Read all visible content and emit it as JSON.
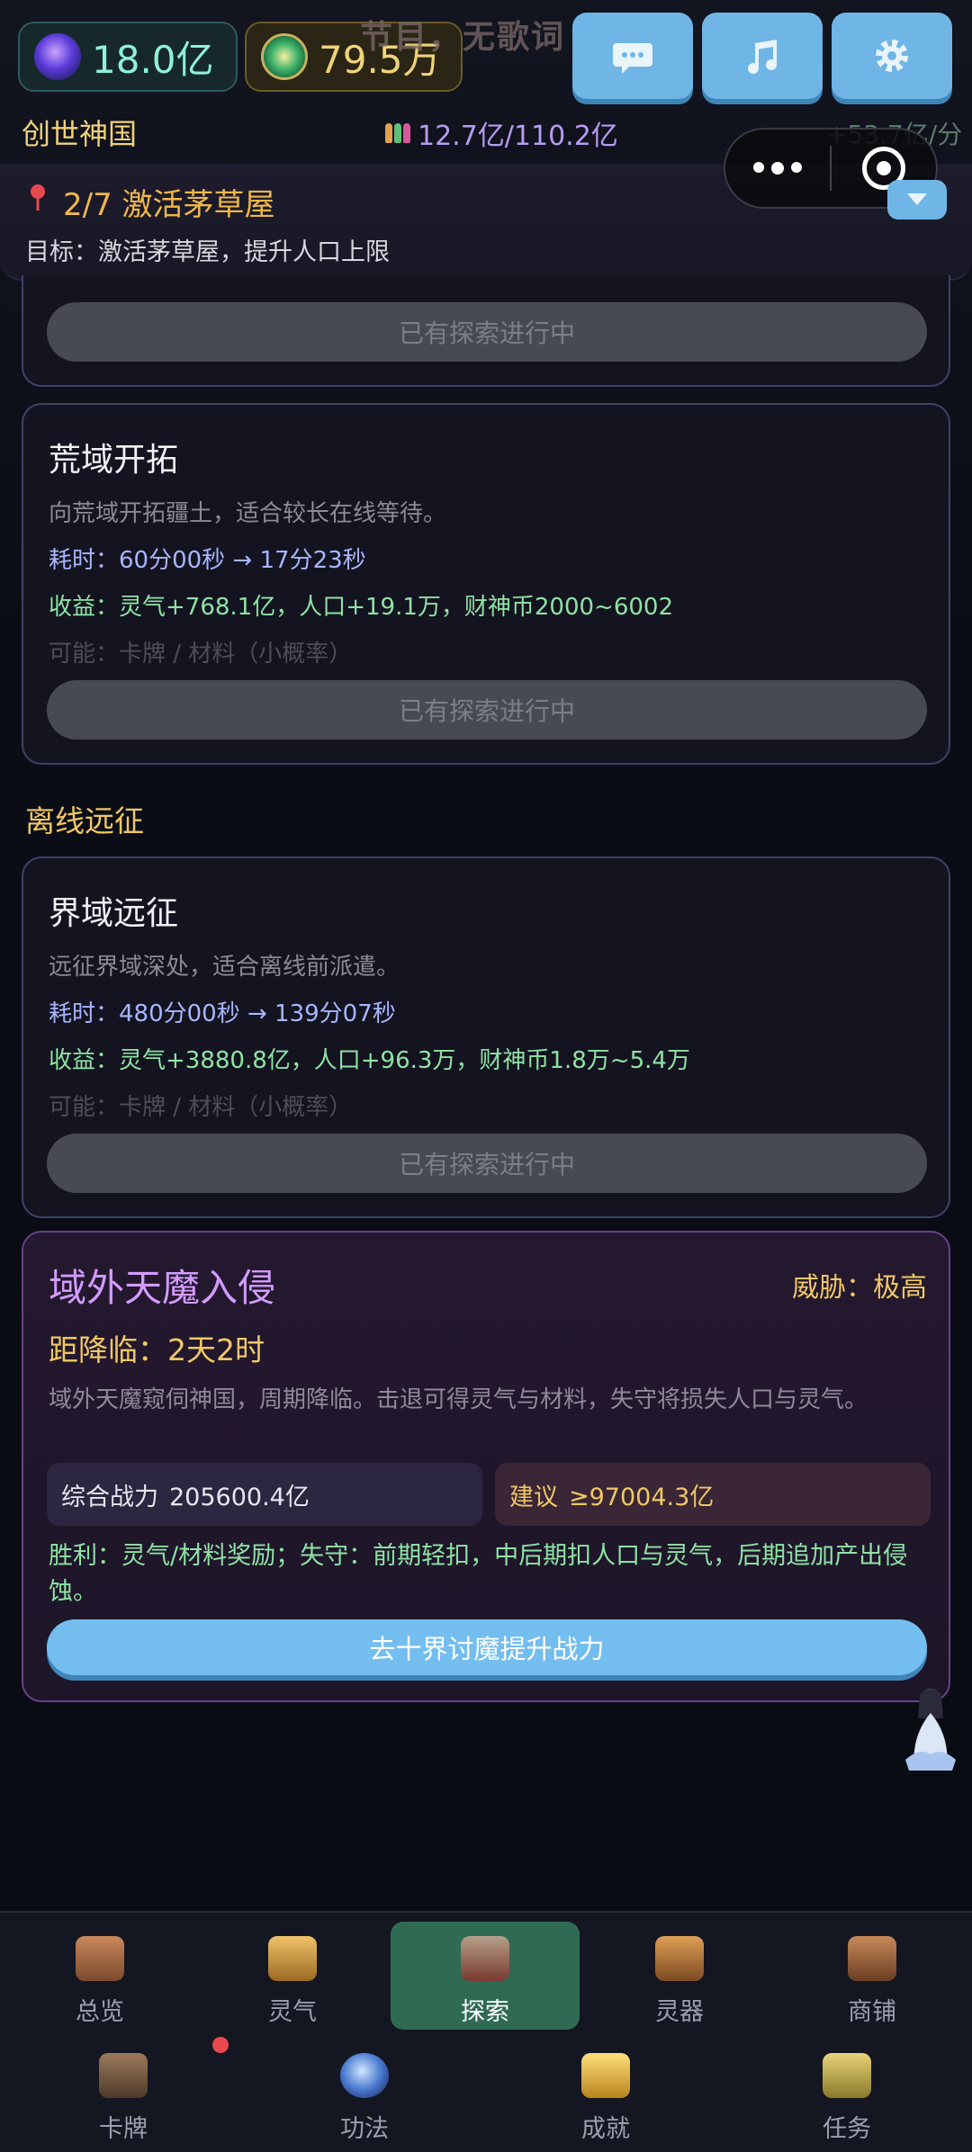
{
  "header": {
    "spirit_value": "18.0亿",
    "coin_value": "79.5万",
    "banner_ghost": "节目，无歌词",
    "kingdom_name": "创世神国",
    "population": "12.7亿/110.2亿",
    "rate": "+53.7亿/分",
    "buttons": {
      "chat_icon": "chat-bubble-icon",
      "music_icon": "music-note-icon",
      "settings_icon": "gear-icon"
    }
  },
  "quest": {
    "title": "2/7  激活茅草屋",
    "goal": "目标：激活茅草屋，提升人口上限"
  },
  "cards": {
    "partial": {
      "button": "已有探索进行中"
    },
    "wild": {
      "title": "荒域开拓",
      "desc": "向荒域开拓疆土，适合较长在线等待。",
      "time": "耗时：60分00秒 → 17分23秒",
      "gain": "收益：灵气+768.1亿，人口+19.1万，财神币2000~6002",
      "maybe": "可能：卡牌 / 材料（小概率）",
      "button": "已有探索进行中"
    }
  },
  "offline_section": "离线远征",
  "offline_card": {
    "title": "界域远征",
    "desc": "远征界域深处，适合离线前派遣。",
    "time": "耗时：480分00秒 → 139分07秒",
    "gain": "收益：灵气+3880.8亿，人口+96.3万，财神币1.8万~5.4万",
    "maybe": "可能：卡牌 / 材料（小概率）",
    "button": "已有探索进行中"
  },
  "demon": {
    "title": "域外天魔入侵",
    "threat_label": "威胁：",
    "threat_value": "极高",
    "countdown_label": "距降临：",
    "countdown_value": "2天2时",
    "desc": "域外天魔窥伺神国，周期降临。击退可得灵气与材料，失守将损失人口与灵气。",
    "power_label": "综合战力",
    "power_value": "205600.4亿",
    "suggest_label": "建议",
    "suggest_value": "≥97004.3亿",
    "rule": "胜利：灵气/材料奖励；失守：前期轻扣，中后期扣人口与灵气，后期追加产出侵蚀。",
    "go_button": "去十界讨魔提升战力"
  },
  "nav": {
    "row1": [
      {
        "label": "总览",
        "icon": "palace-icon"
      },
      {
        "label": "灵气",
        "icon": "treasure-pot-icon"
      },
      {
        "label": "探索",
        "icon": "crossed-swords-icon",
        "active": true
      },
      {
        "label": "灵器",
        "icon": "artifact-icon"
      },
      {
        "label": "商铺",
        "icon": "shop-icon"
      }
    ],
    "row2": [
      {
        "label": "卡牌",
        "icon": "card-pavilion-icon",
        "badge": true
      },
      {
        "label": "功法",
        "icon": "technique-orb-icon"
      },
      {
        "label": "成就",
        "icon": "trophy-icon"
      },
      {
        "label": "任务",
        "icon": "scroll-icon"
      }
    ]
  },
  "colors": {
    "accent_blue": "#6fb6e6",
    "gold": "#f0c865",
    "gain_green": "#8fe3a5",
    "demon_purple": "#d39bff",
    "active_nav": "#2f6b52"
  }
}
